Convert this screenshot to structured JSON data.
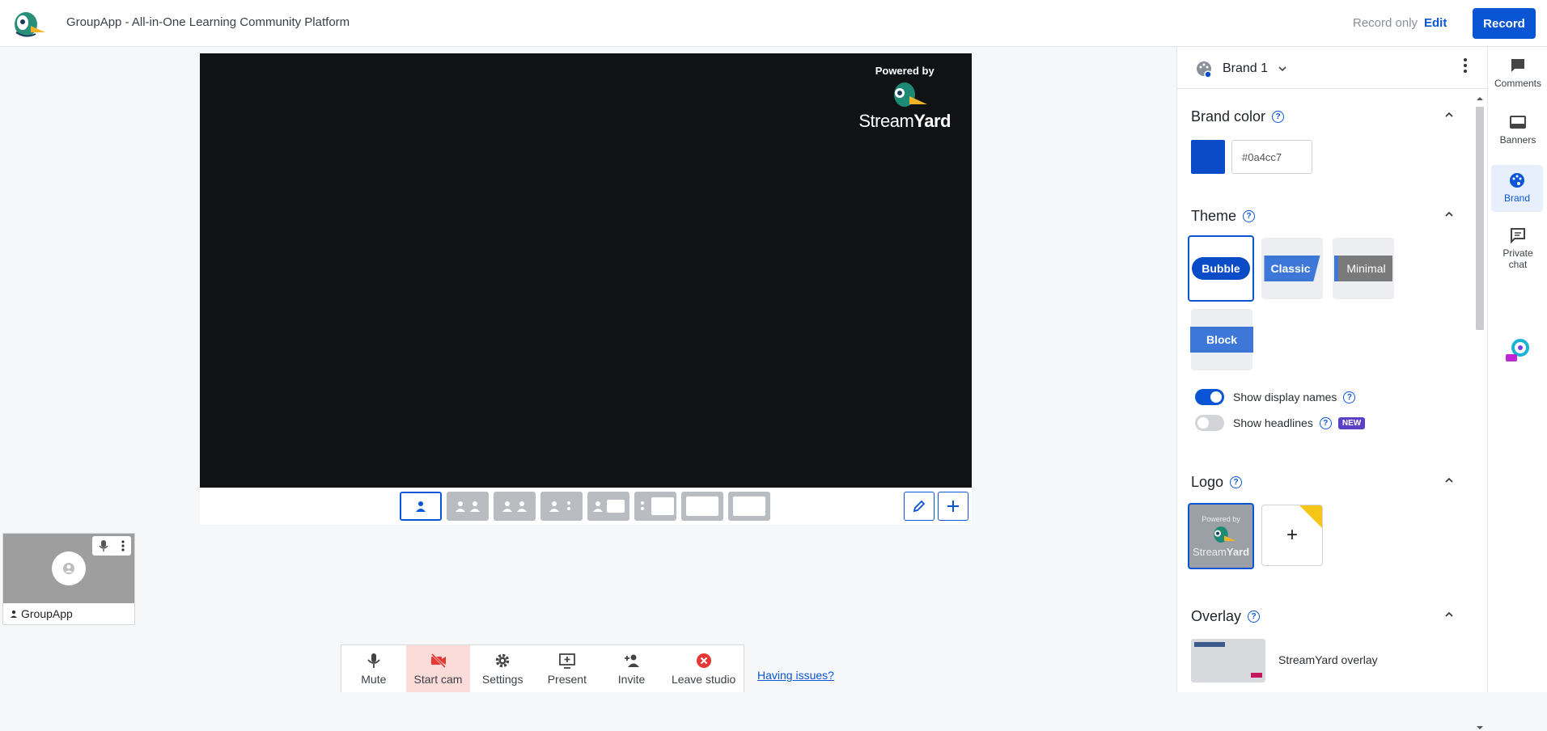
{
  "header": {
    "title": "GroupApp - All-in-One Learning Community Platform",
    "record_only": "Record only",
    "edit": "Edit",
    "record": "Record"
  },
  "stage": {
    "powered_by": "Powered by",
    "brand_stream": "Stream",
    "brand_yard": "Yard"
  },
  "participant": {
    "name": "GroupApp"
  },
  "toolbar": {
    "mute": "Mute",
    "start_cam": "Start cam",
    "settings": "Settings",
    "present": "Present",
    "invite": "Invite",
    "leave": "Leave studio"
  },
  "having_issues": "Having issues?",
  "panel": {
    "brand_name": "Brand 1",
    "brand_color": {
      "title": "Brand color",
      "hex": "#0a4cc7"
    },
    "theme": {
      "title": "Theme",
      "options": [
        "Bubble",
        "Classic",
        "Minimal",
        "Block"
      ],
      "selected": "Bubble"
    },
    "toggles": {
      "display_names": "Show display names",
      "display_names_on": true,
      "headlines": "Show headlines",
      "headlines_on": false,
      "new_badge": "NEW"
    },
    "logo": {
      "title": "Logo",
      "add": "+"
    },
    "overlay": {
      "title": "Overlay",
      "item": "StreamYard overlay"
    }
  },
  "rail": {
    "comments": "Comments",
    "banners": "Banners",
    "brand": "Brand",
    "private_chat": "Private chat"
  },
  "colors": {
    "accent": "#0a55d4",
    "brand": "#0a4cc7",
    "cam_off": "#e53935"
  }
}
